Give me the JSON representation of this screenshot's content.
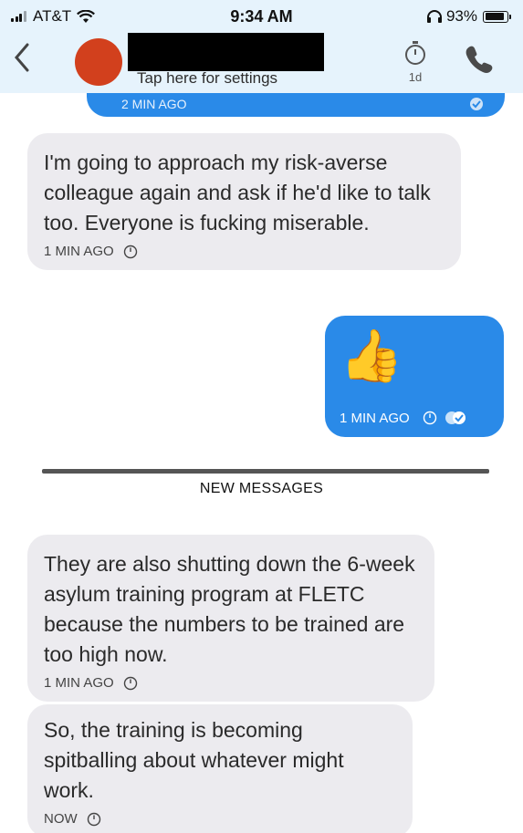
{
  "status_bar": {
    "carrier": "AT&T",
    "time": "9:34 AM",
    "battery": "93%",
    "battery_level": 0.93
  },
  "header": {
    "settings_hint": "Tap here for settings",
    "timer_label": "1d",
    "icons": {
      "back": "chevron-left-icon",
      "timer": "stopwatch-icon",
      "call": "phone-icon"
    }
  },
  "messages": [
    {
      "direction": "outgoing",
      "meta": "2 MIN AGO"
    },
    {
      "direction": "incoming",
      "text": "I'm going to approach my risk-averse colleague again and ask if he'd like to talk too. Everyone is fucking miserable.",
      "meta": "1 MIN AGO"
    },
    {
      "direction": "outgoing",
      "text": "👍",
      "meta": "1 MIN AGO"
    },
    {
      "direction": "incoming",
      "text": "They are also shutting down the 6-week asylum training program at FLETC because the numbers to be trained are too high now.",
      "meta": "1 MIN AGO"
    },
    {
      "direction": "incoming",
      "text": "So, the training is becoming spitballing about whatever might work.",
      "meta": "NOW"
    }
  ],
  "divider_label": "NEW MESSAGES",
  "colors": {
    "header_bg": "#e6f3fc",
    "outgoing_bubble": "#2a8ae8",
    "incoming_bubble": "#ecebef",
    "avatar": "#d2401d"
  }
}
